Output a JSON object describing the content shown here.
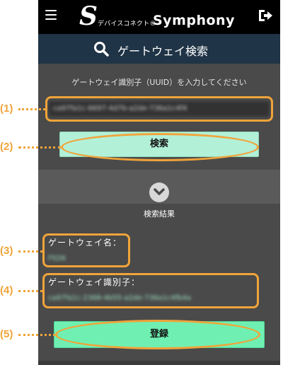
{
  "header": {
    "logo_mark": "S",
    "logo_sub": "デバイスコネクト®",
    "logo_main": "Symphony",
    "menu_icon": "hamburger-icon",
    "logout_icon": "logout-icon"
  },
  "search_bar": {
    "title": "ゲートウェイ検索",
    "icon": "search-icon"
  },
  "search": {
    "hint": "ゲートウェイ識別子（UUID）を入力してください",
    "uuid_value": "ca97fa1c-6697-4d7b-a2de-736a1c4f4",
    "button_label": "検索"
  },
  "results": {
    "toggle_icon": "chevron-down-icon",
    "title": "検索結果",
    "gateway_name_label": "ゲートウェイ名：",
    "gateway_name_value": "F026",
    "gateway_id_label": "ゲートウェイ識別子：",
    "gateway_id_value": "ca97fa1c-2368-4b55-a2de-736a1c4fb4a",
    "register_label": "登録"
  },
  "annotations": {
    "color": "#f0a43a",
    "labels": [
      "(1)",
      "(2)",
      "(3)",
      "(4)",
      "(5)"
    ]
  }
}
